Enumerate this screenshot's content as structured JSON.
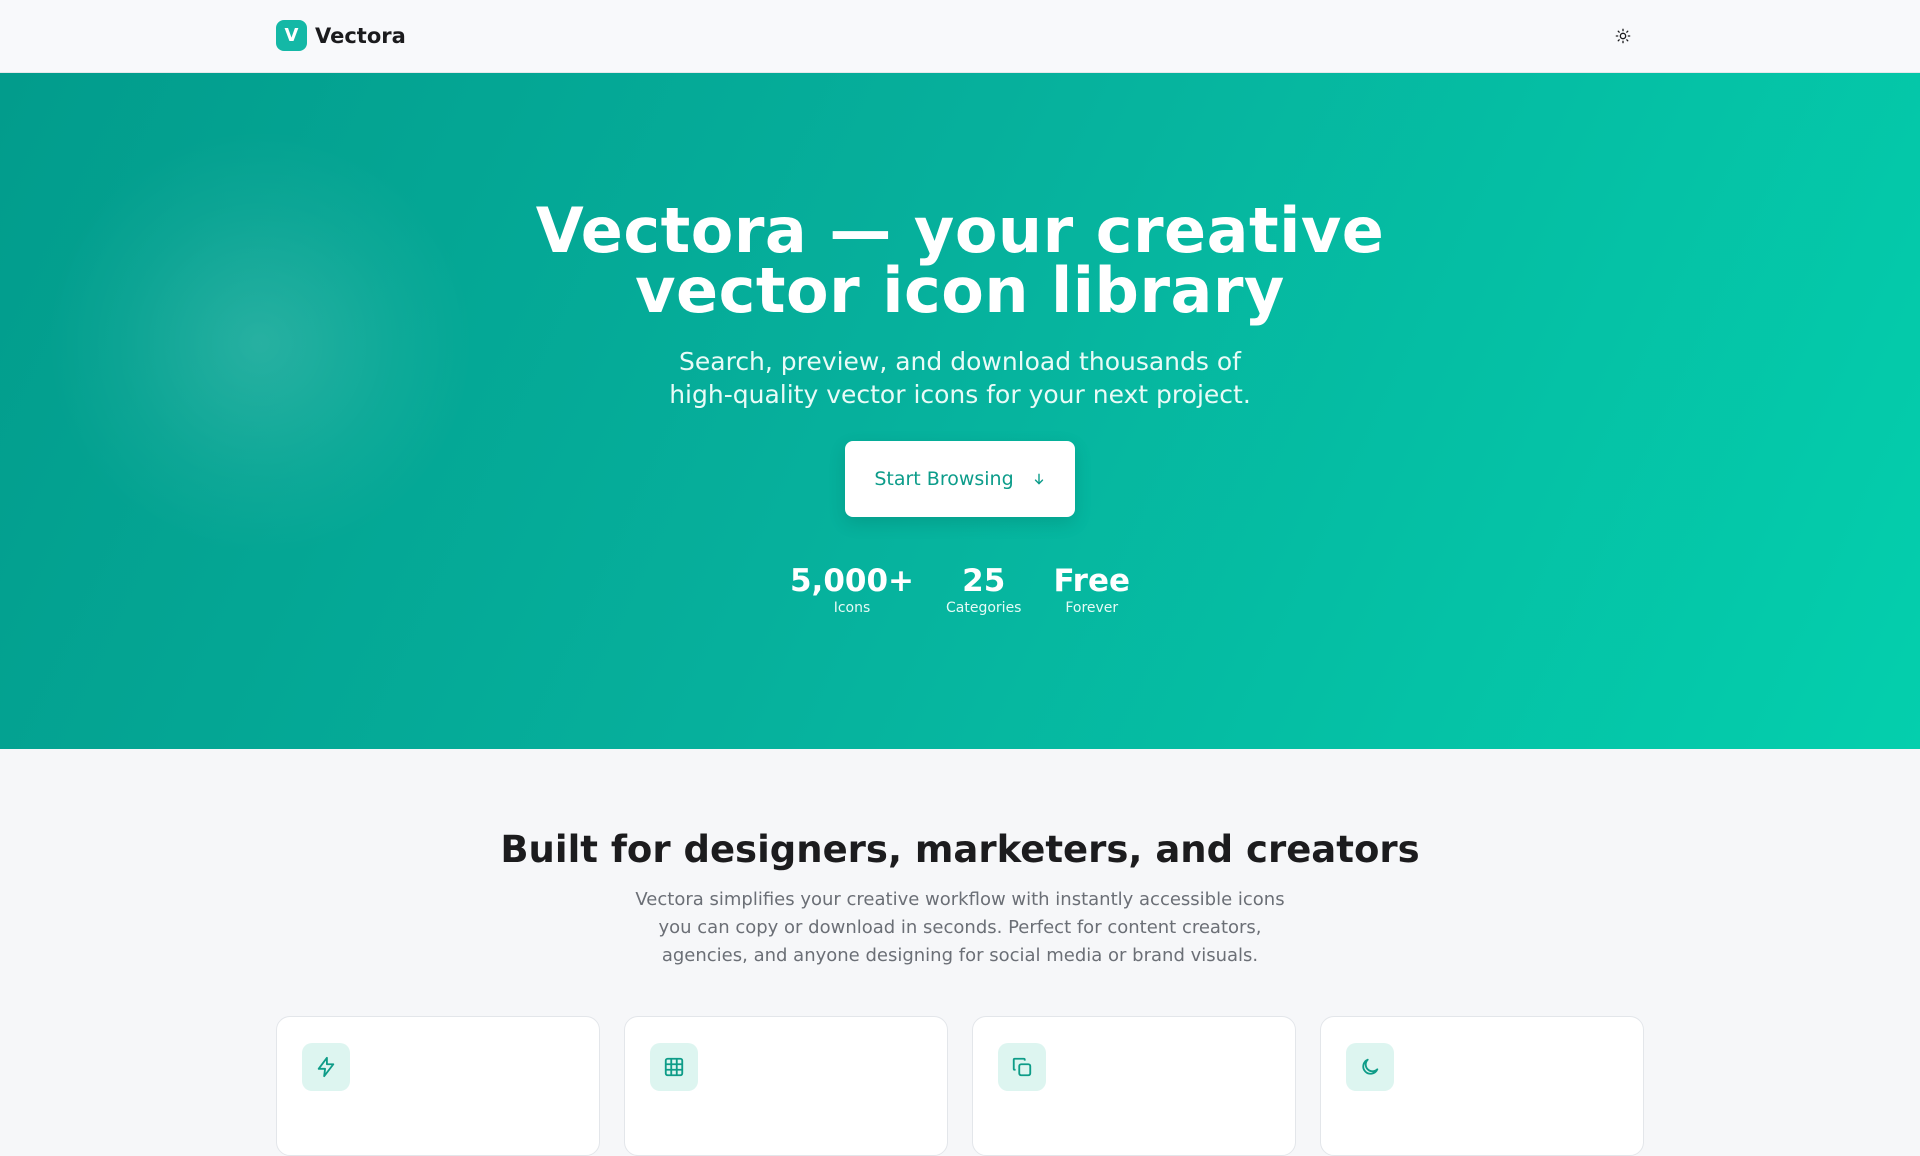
{
  "nav": {
    "brand_letter": "V",
    "brand_name": "Vectora",
    "theme_icon": "sun-icon"
  },
  "hero": {
    "title_line1": "Vectora — your creative",
    "title_line2": "vector icon library",
    "subtitle": "Search, preview, and download thousands of high-quality vector icons for your next project.",
    "cta_label": "Start Browsing",
    "cta_icon": "arrow-down-icon",
    "stats": [
      {
        "value": "5,000+",
        "label": "Icons"
      },
      {
        "value": "25",
        "label": "Categories"
      },
      {
        "value": "Free",
        "label": "Forever"
      }
    ]
  },
  "features": {
    "title": "Built for designers, marketers, and creators",
    "description": "Vectora simplifies your creative workflow with instantly accessible icons you can copy or download in seconds. Perfect for content creators, agencies, and anyone designing for social media or brand visuals.",
    "cards": [
      {
        "icon": "lightning-icon"
      },
      {
        "icon": "grid-icon"
      },
      {
        "icon": "copy-icon"
      },
      {
        "icon": "moon-icon"
      }
    ]
  },
  "colors": {
    "accent": "#14b8a6",
    "hero_start": "#029c8c",
    "hero_end": "#04cfad",
    "cta_text": "#0c9c8a",
    "icon_bg": "#ddf5f0"
  }
}
